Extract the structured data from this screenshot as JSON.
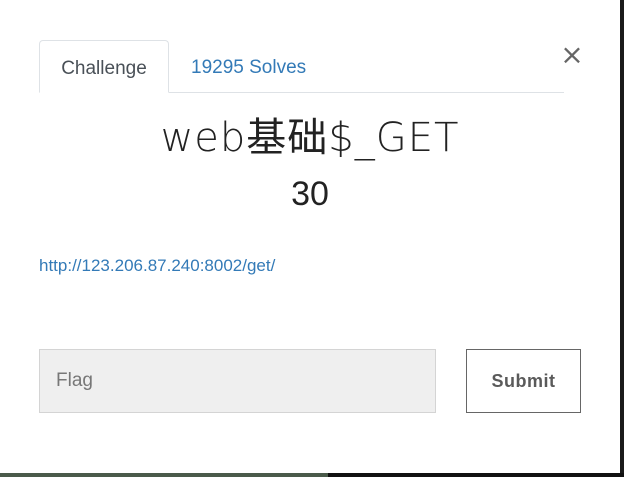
{
  "tabs": [
    {
      "label": "Challenge",
      "active": true
    },
    {
      "label": "19295 Solves",
      "active": false
    }
  ],
  "close": {
    "glyph": "×"
  },
  "challenge": {
    "name": "web基础$_GET",
    "points": "30",
    "description_link": "http://123.206.87.240:8002/get/"
  },
  "form": {
    "flag_placeholder": "Flag",
    "flag_value": "",
    "submit_label": "Submit"
  },
  "colors": {
    "link": "#337ab7",
    "input_bg": "#efefef",
    "tab_border": "#dee2e6"
  }
}
